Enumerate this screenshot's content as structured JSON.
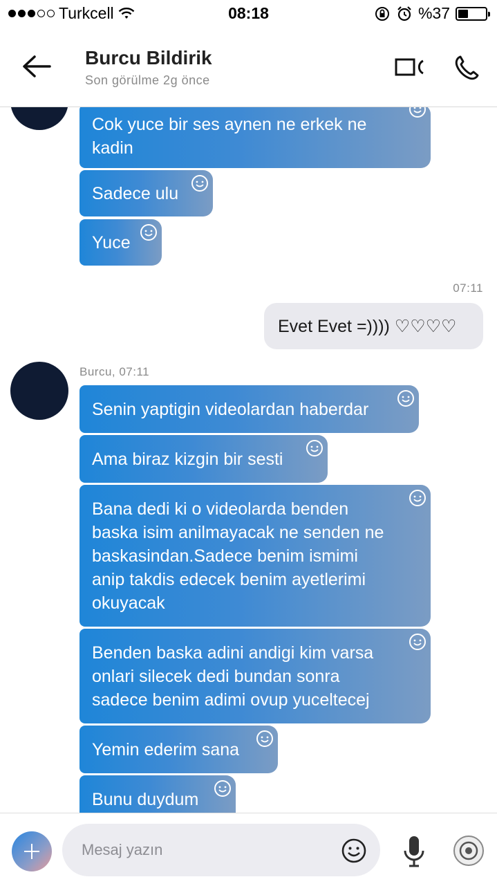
{
  "status_bar": {
    "carrier": "Turkcell",
    "time": "08:18",
    "battery_percent": "%37",
    "battery_level": 0.37,
    "signal_bars_filled": 3,
    "signal_bars_total": 5
  },
  "header": {
    "contact_name": "Burcu Bildirik",
    "last_seen": "Son görülme 2g önce"
  },
  "messages_top": [
    {
      "text": "Cok yuce bir ses aynen ne erkek ne\nkadin"
    },
    {
      "text": "Sadece ulu"
    },
    {
      "text": "Yuce"
    }
  ],
  "outgoing": {
    "time": "07:11",
    "text": "Evet Evet =)))) ♡♡♡♡"
  },
  "incoming_group": {
    "sender_time": "Burcu, 07:11",
    "messages": [
      {
        "text": "Senin yaptigin videolardan haberdar"
      },
      {
        "text": "Ama biraz kizgin bir sesti"
      },
      {
        "text": "Bana dedi ki o videolarda benden\nbaska isim anilmayacak ne senden ne\nbaskasindan.Sadece benim ismimi\nanip takdis edecek benim ayetlerimi\nokuyacak"
      },
      {
        "text": "Benden baska adini andigi kim varsa\nonlari silecek dedi bundan sonra\nsadece benim adimi ovup yuceltecej"
      },
      {
        "text": "Yemin ederim sana"
      },
      {
        "text": "Bunu duydum"
      }
    ]
  },
  "footer": {
    "input_placeholder": "Mesaj yazın"
  },
  "colors": {
    "bubble_start": "#1f86d8",
    "bubble_end": "#7b9cc4",
    "avatar": "#0f1b33",
    "outgoing_bubble": "#e9e9ee"
  }
}
